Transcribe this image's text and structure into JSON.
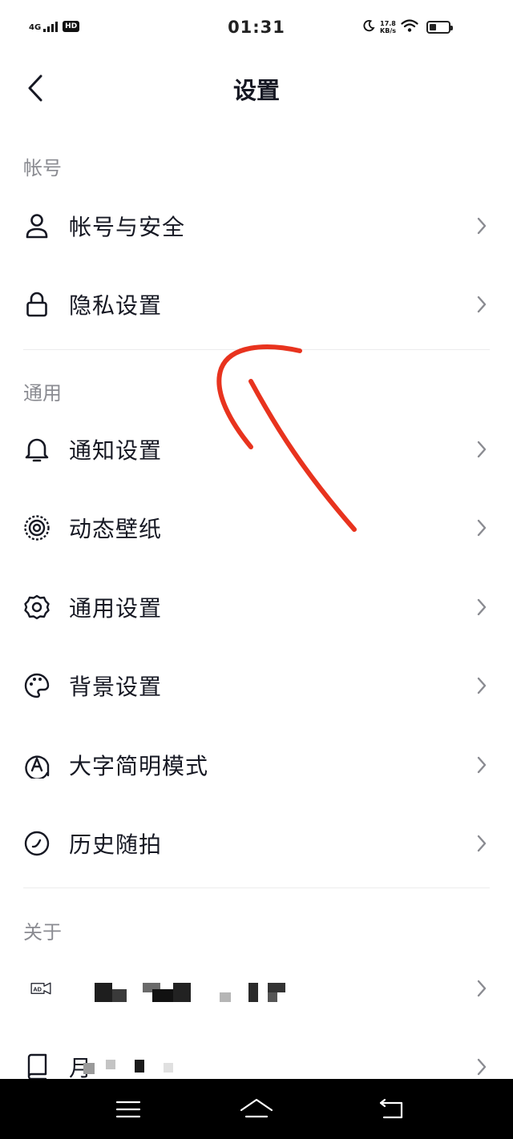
{
  "status_bar": {
    "network": "4G",
    "hd": "HD",
    "time": "01:31",
    "speed_value": "17.8",
    "speed_unit": "KB/s"
  },
  "header": {
    "title": "设置"
  },
  "sections": {
    "account": {
      "title": "帐号",
      "items": [
        {
          "label": "帐号与安全",
          "icon": "user-icon"
        },
        {
          "label": "隐私设置",
          "icon": "lock-icon"
        }
      ]
    },
    "general": {
      "title": "通用",
      "items": [
        {
          "label": "通知设置",
          "icon": "bell-icon"
        },
        {
          "label": "动态壁纸",
          "icon": "live-wallpaper-icon"
        },
        {
          "label": "通用设置",
          "icon": "gear-icon"
        },
        {
          "label": "背景设置",
          "icon": "palette-icon"
        },
        {
          "label": "大字简明模式",
          "icon": "large-font-icon"
        },
        {
          "label": "历史随拍",
          "icon": "history-snap-icon"
        }
      ]
    },
    "about": {
      "title": "关于",
      "items": [
        {
          "label": "",
          "icon": "ad-icon"
        },
        {
          "label": "月",
          "icon": "book-icon"
        }
      ]
    }
  },
  "colors": {
    "text_primary": "#161823",
    "text_secondary": "#8a8b91",
    "annotation_stroke": "#e8331e"
  }
}
